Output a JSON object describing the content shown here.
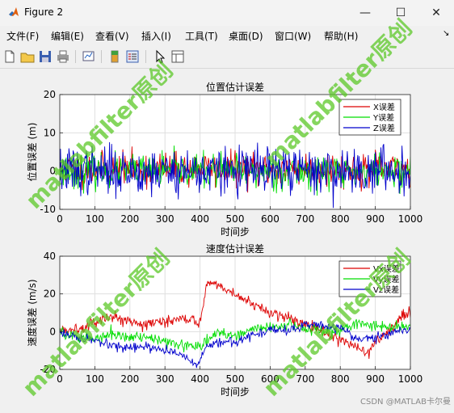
{
  "window": {
    "title": "Figure 2"
  },
  "menu": [
    "文件(F)",
    "编辑(E)",
    "查看(V)",
    "插入(I)",
    "工具(T)",
    "桌面(D)",
    "窗口(W)",
    "帮助(H)"
  ],
  "toolbar_icons": [
    "new-file-icon",
    "open-folder-icon",
    "save-icon",
    "print-icon",
    "link-plot-icon",
    "insert-colorbar-icon",
    "insert-legend-icon",
    "edit-pointer-icon",
    "property-inspector-icon"
  ],
  "colors": {
    "x": "#dd0000",
    "y": "#00dd00",
    "z": "#0000cc",
    "grid": "#dfdfdf",
    "watermark": "#5cc828"
  },
  "watermark": "matlabfilter原创",
  "credit": "CSDN @MATLAB卡尔曼",
  "chart_data": [
    {
      "type": "line",
      "title": "位置估计误差",
      "xlabel": "时间步",
      "ylabel": "位置误差 (m)",
      "xlim": [
        0,
        1000
      ],
      "ylim": [
        -10,
        20
      ],
      "xticks": [
        0,
        100,
        200,
        300,
        400,
        500,
        600,
        700,
        800,
        900,
        1000
      ],
      "yticks": [
        -10,
        0,
        10,
        20
      ],
      "grid": true,
      "legend_position": "top-right",
      "series": [
        {
          "name": "X误差",
          "color": "#dd0000",
          "kind": "noise",
          "mean": 0.5,
          "amplitude": 3.5,
          "seed": 11
        },
        {
          "name": "Y误差",
          "color": "#00dd00",
          "kind": "noise",
          "mean": 0.0,
          "amplitude": 3.5,
          "seed": 23
        },
        {
          "name": "Z误差",
          "color": "#0000cc",
          "kind": "noise",
          "mean": 0.0,
          "amplitude": 5.0,
          "seed": 37
        }
      ]
    },
    {
      "type": "line",
      "title": "速度估计误差",
      "xlabel": "时间步",
      "ylabel": "速度误差 (m/s)",
      "xlim": [
        0,
        1000
      ],
      "ylim": [
        -20,
        40
      ],
      "xticks": [
        0,
        100,
        200,
        300,
        400,
        500,
        600,
        700,
        800,
        900,
        1000
      ],
      "yticks": [
        -20,
        0,
        20,
        40
      ],
      "grid": true,
      "legend_position": "top-right",
      "series": [
        {
          "name": "Vx误差",
          "color": "#dd0000",
          "kind": "trend",
          "noise": 1.5,
          "seed": 5,
          "points": [
            [
              0,
              0
            ],
            [
              50,
              2
            ],
            [
              100,
              5
            ],
            [
              150,
              8
            ],
            [
              200,
              6
            ],
            [
              250,
              4
            ],
            [
              300,
              5
            ],
            [
              350,
              8
            ],
            [
              400,
              5
            ],
            [
              420,
              26
            ],
            [
              450,
              25
            ],
            [
              500,
              20
            ],
            [
              550,
              14
            ],
            [
              600,
              10
            ],
            [
              650,
              8
            ],
            [
              700,
              4
            ],
            [
              750,
              0
            ],
            [
              800,
              -5
            ],
            [
              850,
              -8
            ],
            [
              880,
              -12
            ],
            [
              900,
              -5
            ],
            [
              950,
              2
            ],
            [
              980,
              9
            ],
            [
              1000,
              10
            ]
          ]
        },
        {
          "name": "Vy误差",
          "color": "#00dd00",
          "kind": "trend",
          "noise": 1.5,
          "seed": 9,
          "points": [
            [
              0,
              0
            ],
            [
              50,
              -3
            ],
            [
              100,
              -4
            ],
            [
              150,
              -2
            ],
            [
              200,
              -3
            ],
            [
              250,
              -3
            ],
            [
              300,
              -5
            ],
            [
              350,
              -7
            ],
            [
              400,
              -8
            ],
            [
              420,
              -5
            ],
            [
              450,
              0
            ],
            [
              500,
              -3
            ],
            [
              550,
              2
            ],
            [
              600,
              2
            ],
            [
              650,
              4
            ],
            [
              700,
              2
            ],
            [
              750,
              0
            ],
            [
              800,
              1
            ],
            [
              850,
              5
            ],
            [
              900,
              3
            ],
            [
              950,
              2
            ],
            [
              1000,
              3
            ]
          ]
        },
        {
          "name": "Vz误差",
          "color": "#0000cc",
          "kind": "trend",
          "noise": 1.2,
          "seed": 17,
          "points": [
            [
              0,
              0
            ],
            [
              50,
              -3
            ],
            [
              100,
              -5
            ],
            [
              150,
              -8
            ],
            [
              200,
              -9
            ],
            [
              250,
              -8
            ],
            [
              300,
              -10
            ],
            [
              350,
              -12
            ],
            [
              395,
              -18
            ],
            [
              420,
              -8
            ],
            [
              450,
              -6
            ],
            [
              500,
              -5
            ],
            [
              550,
              -2
            ],
            [
              600,
              1
            ],
            [
              650,
              0
            ],
            [
              700,
              4
            ],
            [
              750,
              3
            ],
            [
              800,
              2
            ],
            [
              850,
              -4
            ],
            [
              900,
              -3
            ],
            [
              950,
              0
            ],
            [
              1000,
              1
            ]
          ]
        }
      ]
    }
  ]
}
